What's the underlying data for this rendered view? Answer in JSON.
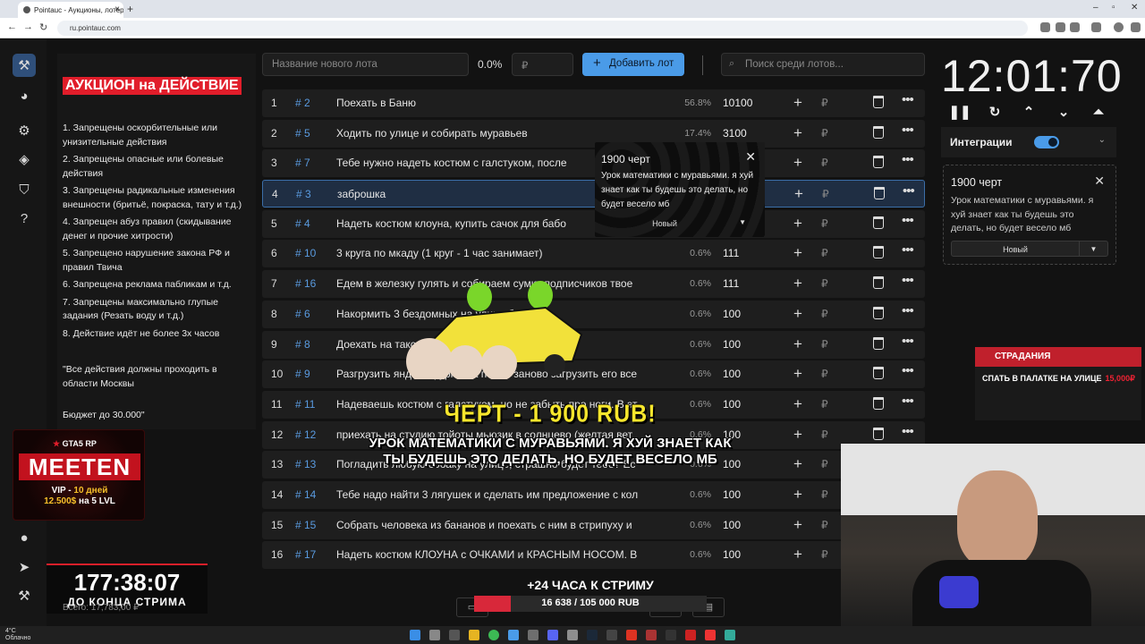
{
  "browser": {
    "tab_title": "Pointauc - Аукционы, лотере",
    "url": "ru.pointauc.com"
  },
  "rules": {
    "title": "АУКЦИОН на ДЕЙСТВИЕ",
    "items": [
      "1. Запрещены оскорбительные или унизительные действия",
      "2. Запрещены опасные или болевые действия",
      "3. Запрещены радикальные изменения внешности (бритьё, покраска, тату и т.д.)",
      "4. Запрещен абуз правил (скидывание денег и прочие хитрости)",
      "5. Запрещено нарушение закона РФ и правил Твича",
      "6. Запрещена реклама пабликам и т.д.",
      "7.  Запрещены максимально глупые задания (Резать воду и т.д.)",
      "8. Действие идёт не более 3х часов"
    ],
    "quote": "\"Все действия должны проходить в области Москвы",
    "budget": "Бюджет до 30.000\""
  },
  "banner": {
    "gta": "GTA5 RP",
    "name": "MEETEN",
    "vip_line1": "VIP -",
    "vip_days": "10 дней",
    "vip_line2_a": "12.500$",
    "vip_line2_b": "на 5 LVL"
  },
  "stream_timer": {
    "time": "177:38:07",
    "label": "ДО КОНЦА СТРИМА"
  },
  "total": "Всего: 17,783,00 ₽",
  "toolbar": {
    "new_lot_placeholder": "Название нового лота",
    "percent": "0.0%",
    "amount_placeholder": "₽",
    "add_label": "Добавить лот",
    "search_placeholder": "Поиск среди лотов..."
  },
  "lots": [
    {
      "n": "1",
      "id": "# 2",
      "name": "Поехать в Баню",
      "pct": "56.8%",
      "amount": "10100"
    },
    {
      "n": "2",
      "id": "# 5",
      "name": "Ходить по улице и собирать муравьев",
      "pct": "17.4%",
      "amount": "3100"
    },
    {
      "n": "3",
      "id": "# 7",
      "name": "Тебе нужно надеть костюм с галстуком, после",
      "pct": "",
      "amount": ""
    },
    {
      "n": "4",
      "id": "# 3",
      "name": "заброшка",
      "pct": "",
      "amount": ""
    },
    {
      "n": "5",
      "id": "# 4",
      "name": "Надеть костюм клоуна, купить сачок для бабо",
      "pct": "",
      "amount": ""
    },
    {
      "n": "6",
      "id": "# 10",
      "name": "3 круга по мкаду (1 круг - 1 час занимает)",
      "pct": "0.6%",
      "amount": "111"
    },
    {
      "n": "7",
      "id": "# 16",
      "name": "Едем в железку гулять и собираем сумку подписчиков твое",
      "pct": "0.6%",
      "amount": "111"
    },
    {
      "n": "8",
      "id": "# 6",
      "name": "Накормить 3 бездомных на улице бургеров",
      "pct": "0.6%",
      "amount": "100"
    },
    {
      "n": "9",
      "id": "# 8",
      "name": "Доехать на такси в детский лагерь, прям т",
      "pct": "0.6%",
      "amount": "100"
    },
    {
      "n": "10",
      "id": "# 9",
      "name": "Разгрузить яндекс фургон, а потом заново загрузить его все",
      "pct": "0.6%",
      "amount": "100"
    },
    {
      "n": "11",
      "id": "# 11",
      "name": "Надеваешь костюм с галстуком, но не забыть про ноги. В эт",
      "pct": "0.6%",
      "amount": "100"
    },
    {
      "n": "12",
      "id": "# 12",
      "name": "приехать на студию тойоты мьюзик в солнцево (желтая вет",
      "pct": "0.6%",
      "amount": "100"
    },
    {
      "n": "13",
      "id": "# 13",
      "name": "Погладить любую собаку на улице, страшно будет тебе? Ес",
      "pct": "0.6%",
      "amount": "100"
    },
    {
      "n": "14",
      "id": "# 14",
      "name": "Тебе надо найти 3 лягушек и сделать им предложение с кол",
      "pct": "0.6%",
      "amount": "100"
    },
    {
      "n": "15",
      "id": "# 15",
      "name": "Собрать человека из бананов и поехать с ним в стрипуху и",
      "pct": "0.6%",
      "amount": "100"
    },
    {
      "n": "16",
      "id": "# 17",
      "name": "Надеть костюм КЛОУНА с ОЧКАМИ и КРАСНЫМ НОСОМ. В",
      "pct": "0.6%",
      "amount": "100"
    }
  ],
  "currency": "₽",
  "clock": "12:01:70",
  "integrations": {
    "label": "Интеграции"
  },
  "donation": {
    "amount": "1900 черт",
    "message": "Урок математики с муравьями. я хуй знает как ты будешь это делать, но будет весело мб",
    "status": "Новый"
  },
  "popup": {
    "amount": "1900 черт",
    "message": "Урок математики с муравьями. я хуй знает как ты будешь это делать, но будет весело мб",
    "status": "Новый"
  },
  "alert": {
    "title": "ЧЕРТ - 1 900 RUB!",
    "message": "УРОК МАТЕМАТИКИ С МУРАВЬЯМИ. Я ХУЙ ЗНАЕТ КАК ТЫ БУДЕШЬ ЭТО ДЕЛАТЬ, НО БУДЕТ ВЕСЕЛО МБ"
  },
  "goal": {
    "title": "+24 ЧАСА К СТРИМУ",
    "value": "16 638 / 105 000 RUB",
    "progress": 0.158
  },
  "suffer": {
    "title": "СТРАДАНИЯ",
    "item": "СПАТЬ В ПАЛАТКЕ НА УЛИЦЕ",
    "price": "15,000₽"
  },
  "taskbar": {
    "temp": "4°C",
    "weather": "Облачно"
  },
  "colors": {
    "accent": "#4a9be8",
    "brand_red": "#e11d2a",
    "alert_yellow": "#f6e62d"
  }
}
